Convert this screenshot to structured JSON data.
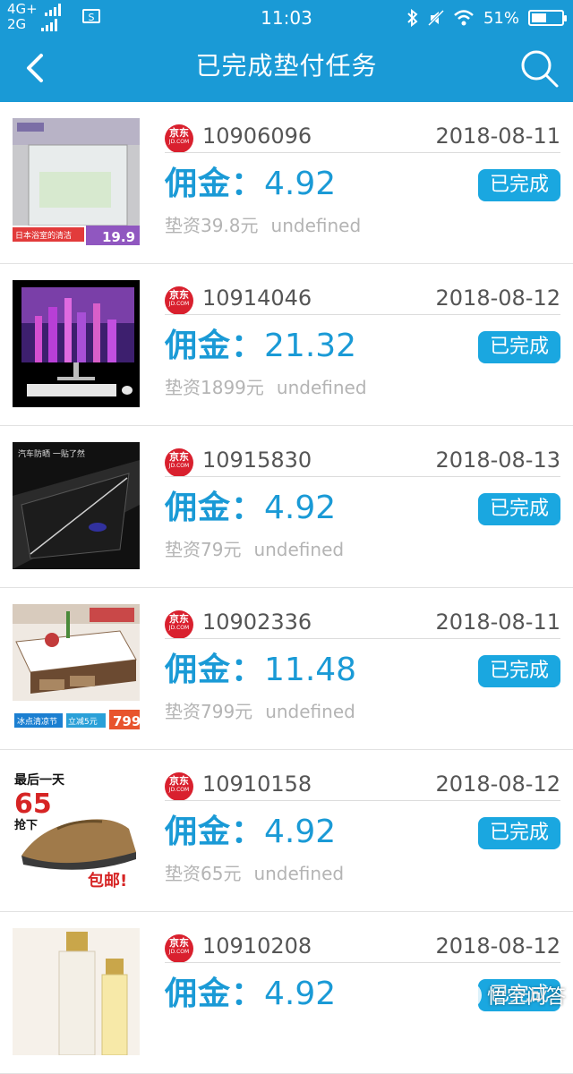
{
  "status_bar": {
    "signal_top": "4G+",
    "signal_bottom": "2G",
    "sim_icon": "S",
    "time": "11:03",
    "battery_percent_label": "51%",
    "battery_level": 0.51
  },
  "nav": {
    "title": "已完成垫付任务",
    "back_icon": "chevron-left-icon",
    "search_icon": "search-icon"
  },
  "colors": {
    "primary": "#1a9ad6",
    "button": "#1aa7e0",
    "jd_red": "#d9202e",
    "muted": "#b4b4b4"
  },
  "platform_logo": {
    "cn": "京东",
    "en": "JD.COM"
  },
  "orders": [
    {
      "id": "10906096",
      "date": "2018-08-11",
      "commission_label": "佣金：",
      "commission": "4.92",
      "advance": "垫资39.8元",
      "extra": "undefined",
      "status": "已完成",
      "thumb_caption": "日本浴室的清洁",
      "thumb_price": "19.9"
    },
    {
      "id": "10914046",
      "date": "2018-08-12",
      "commission_label": "佣金：",
      "commission": "21.32",
      "advance": "垫资1899元",
      "extra": "undefined",
      "status": "已完成"
    },
    {
      "id": "10915830",
      "date": "2018-08-13",
      "commission_label": "佣金：",
      "commission": "4.92",
      "advance": "垫资79元",
      "extra": "undefined",
      "status": "已完成",
      "thumb_caption": "汽车防晒 一贴了然"
    },
    {
      "id": "10902336",
      "date": "2018-08-11",
      "commission_label": "佣金：",
      "commission": "11.48",
      "advance": "垫资799元",
      "extra": "undefined",
      "status": "已完成",
      "thumb_caption": "冰点清凉节",
      "thumb_badge": "立减5元",
      "thumb_price": "799"
    },
    {
      "id": "10910158",
      "date": "2018-08-12",
      "commission_label": "佣金：",
      "commission": "4.92",
      "advance": "垫资65元",
      "extra": "undefined",
      "status": "已完成",
      "thumb_caption": "最后一天",
      "thumb_price": "65",
      "thumb_sub": "抢下",
      "thumb_tag": "包邮!"
    },
    {
      "id": "10910208",
      "date": "2018-08-12",
      "commission_label": "佣金：",
      "commission": "4.92",
      "advance": "",
      "extra": "",
      "status": "已完成"
    }
  ],
  "watermark": {
    "text": "悟空问答"
  }
}
